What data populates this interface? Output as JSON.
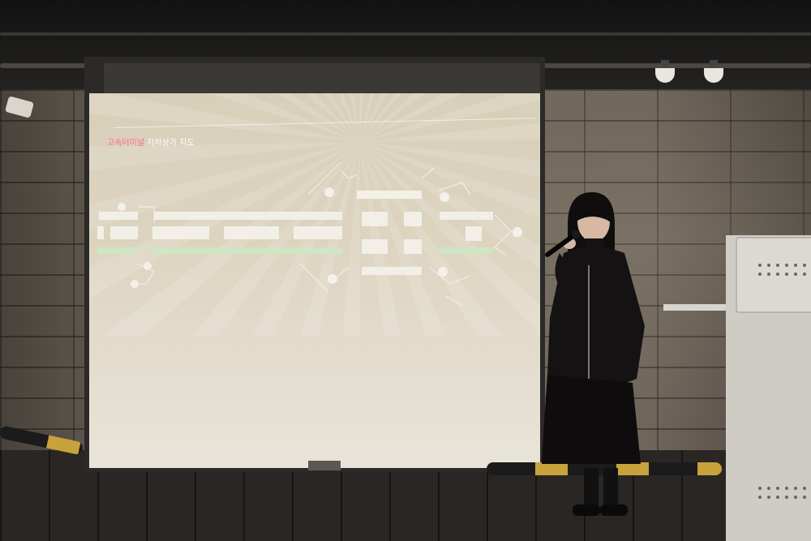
{
  "slide": {
    "title_highlight": "고속터미널",
    "title_rest": " 지하상가 지도"
  },
  "colors": {
    "screen": "#ddd4c0",
    "highlight_text": "#ff6b8a",
    "wall": "#6e655b",
    "floor": "#2a2623",
    "bumper_yellow": "#c8a23a"
  },
  "icons": [
    "ceiling-spotlight-icon",
    "microphone-icon"
  ]
}
